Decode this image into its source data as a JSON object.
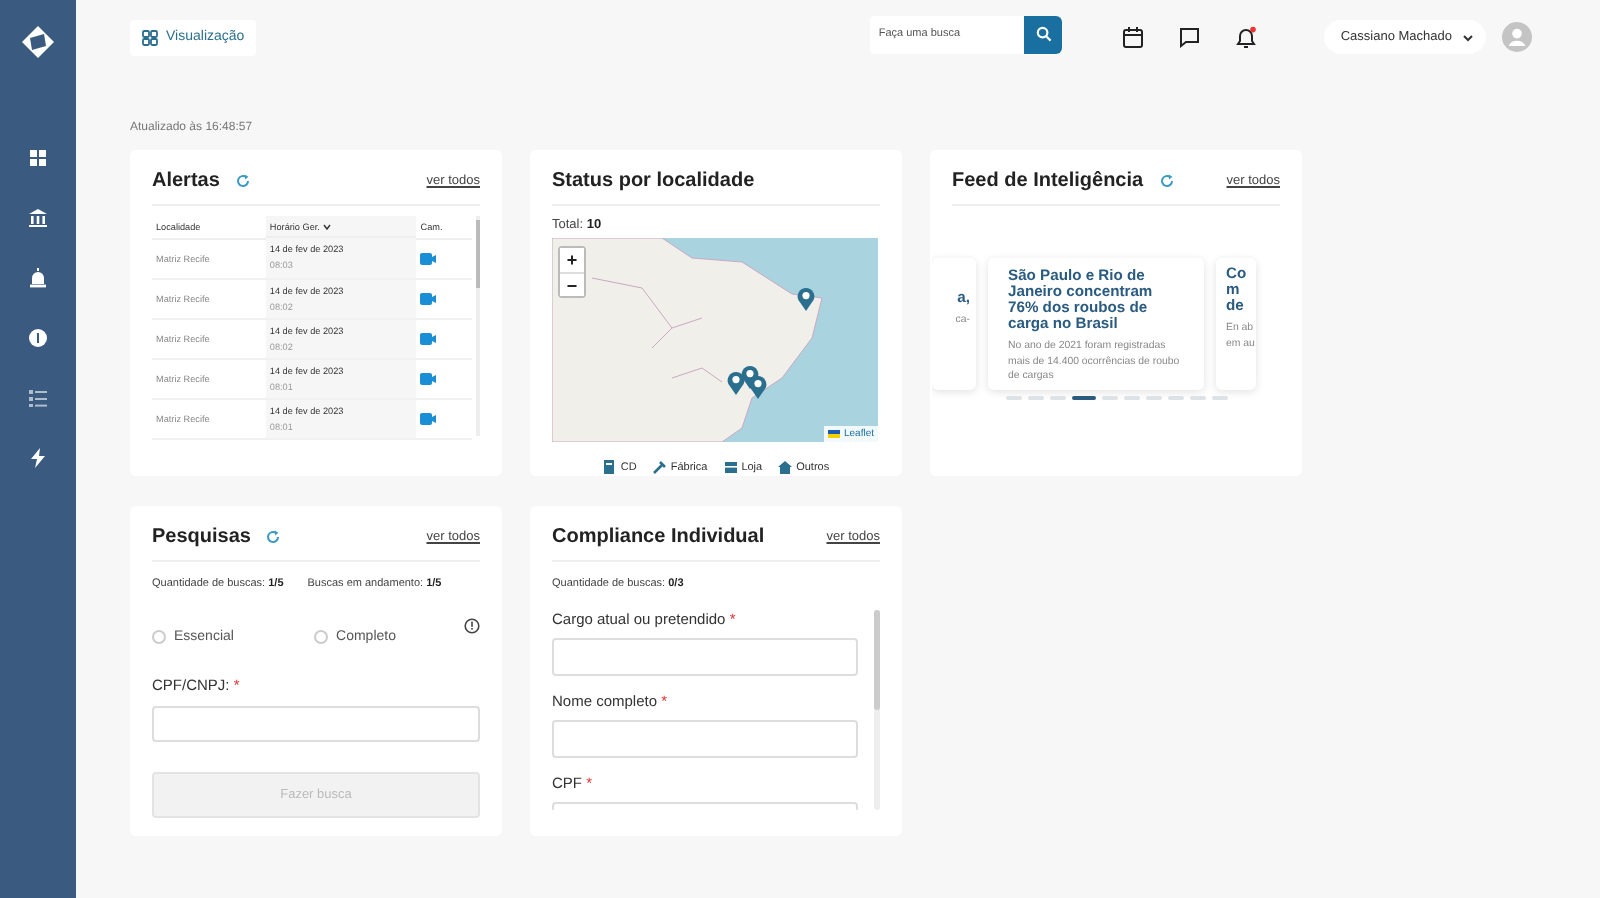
{
  "topbar": {
    "view_button": "Visualização",
    "search": {
      "placeholder": "Faça uma busca"
    },
    "has_unread_notifications": true,
    "user": "Cassiano Machado"
  },
  "updated": "Atualizado às 16:48:57",
  "alerts": {
    "title": "Alertas",
    "link": "ver todos",
    "columns": [
      "Localidade",
      "Horário Ger.",
      "Cam."
    ],
    "rows": [
      {
        "location": "Matriz Recife",
        "date": "14 de fev de 2023",
        "time": "08:03"
      },
      {
        "location": "Matriz Recife",
        "date": "14 de fev de 2023",
        "time": "08:02"
      },
      {
        "location": "Matriz Recife",
        "date": "14 de fev de 2023",
        "time": "08:02"
      },
      {
        "location": "Matriz Recife",
        "date": "14 de fev de 2023",
        "time": "08:01"
      },
      {
        "location": "Matriz Recife",
        "date": "14 de fev de 2023",
        "time": "08:01"
      }
    ]
  },
  "status": {
    "title": "Status por localidade",
    "total_label": "Total:",
    "total": "10",
    "zoom_in": "+",
    "zoom_out": "−",
    "attribution": "Leaflet",
    "legend": [
      {
        "kind": "cd",
        "label": "CD"
      },
      {
        "kind": "factory",
        "label": "Fábrica"
      },
      {
        "kind": "store",
        "label": "Loja"
      },
      {
        "kind": "other",
        "label": "Outros"
      }
    ]
  },
  "feed": {
    "title": "Feed de Inteligência",
    "link": "ver todos",
    "cards": [
      {
        "title": "a,",
        "text": "ca-"
      },
      {
        "title": "São Paulo e Rio de Janeiro concentram 76% dos roubos de carga no Brasil",
        "text": "No ano de 2021 foram registradas mais de 14.400 ocorrências de roubo de cargas"
      },
      {
        "title": "Co m de",
        "text": "En ab em au"
      }
    ],
    "dots": [
      {
        "selected": false
      },
      {
        "selected": false
      },
      {
        "selected": false
      },
      {
        "selected": true
      },
      {
        "selected": false
      },
      {
        "selected": false
      },
      {
        "selected": false
      },
      {
        "selected": false
      },
      {
        "selected": false
      },
      {
        "selected": false
      }
    ]
  },
  "searches": {
    "title": "Pesquisas",
    "link": "ver todos",
    "counts": [
      "Quantidade de buscas: **1/5**",
      "Buscas em andamento: **1/5**"
    ],
    "radios": [
      {
        "label": "Essencial",
        "selected": false
      },
      {
        "label": "Completo",
        "selected": false
      }
    ],
    "field": {
      "label": "CPF/CNPJ:",
      "required_mark": "*"
    },
    "button": {
      "label": "Fazer busca",
      "disabled": true
    }
  },
  "compliance": {
    "title": "Compliance Individual",
    "link": "ver todos",
    "count": "Quantidade de buscas: **0/3**",
    "fields": [
      {
        "label": "Cargo atual ou pretendido",
        "required_mark": "*"
      },
      {
        "label": "Nome completo",
        "required_mark": "*"
      },
      {
        "label": "CPF",
        "required_mark": "*"
      }
    ]
  }
}
